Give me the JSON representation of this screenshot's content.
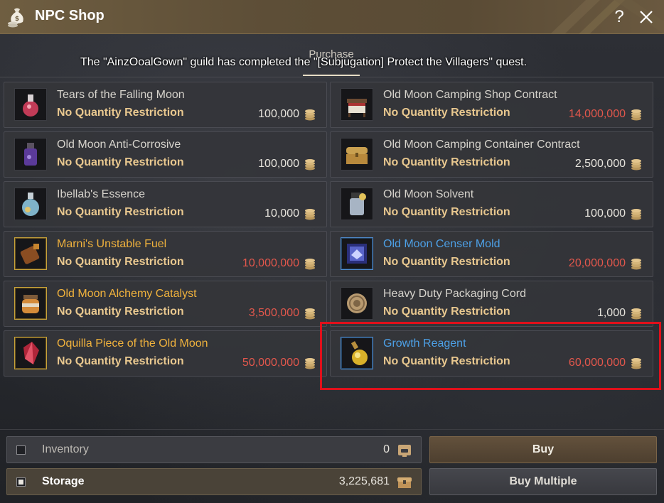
{
  "window": {
    "title": "NPC Shop",
    "title_icon": "money-bag-icon",
    "help_label": "?",
    "close_icon": "close-icon"
  },
  "tabs": {
    "active": "Purchase"
  },
  "notice": "The \"AinzOoalGown\" guild has completed the \"[Subjugation] Protect the Villagers\" quest.",
  "items": [
    {
      "name": "Tears of the Falling Moon",
      "restriction": "No Quantity Restriction",
      "price": "100,000",
      "grade": "white",
      "price_color": "normal",
      "icon": "potion-flask-icon"
    },
    {
      "name": "Old Moon Camping Shop Contract",
      "restriction": "No Quantity Restriction",
      "price": "14,000,000",
      "grade": "white",
      "price_color": "red",
      "icon": "shop-stall-icon"
    },
    {
      "name": "Old Moon Anti-Corrosive",
      "restriction": "No Quantity Restriction",
      "price": "100,000",
      "grade": "white",
      "price_color": "normal",
      "icon": "purple-bottle-icon"
    },
    {
      "name": "Old Moon Camping Container Contract",
      "restriction": "No Quantity Restriction",
      "price": "2,500,000",
      "grade": "white",
      "price_color": "normal",
      "icon": "treasure-chest-icon"
    },
    {
      "name": "Ibellab's Essence",
      "restriction": "No Quantity Restriction",
      "price": "10,000",
      "grade": "white",
      "price_color": "normal",
      "icon": "essence-flask-icon"
    },
    {
      "name": "Old Moon Solvent",
      "restriction": "No Quantity Restriction",
      "price": "100,000",
      "grade": "white",
      "price_color": "normal",
      "icon": "solvent-jar-icon"
    },
    {
      "name": "Marni's Unstable Fuel",
      "restriction": "No Quantity Restriction",
      "price": "10,000,000",
      "grade": "gold",
      "price_color": "red",
      "icon": "fuel-canister-icon"
    },
    {
      "name": "Old Moon Censer Mold",
      "restriction": "No Quantity Restriction",
      "price": "20,000,000",
      "grade": "blue",
      "price_color": "red",
      "icon": "censer-mold-icon"
    },
    {
      "name": "Old Moon Alchemy Catalyst",
      "restriction": "No Quantity Restriction",
      "price": "3,500,000",
      "grade": "gold",
      "price_color": "red",
      "icon": "catalyst-jar-icon"
    },
    {
      "name": "Heavy Duty Packaging Cord",
      "restriction": "No Quantity Restriction",
      "price": "1,000",
      "grade": "white",
      "price_color": "normal",
      "icon": "rope-coil-icon"
    },
    {
      "name": "Oquilla Piece of the Old Moon",
      "restriction": "No Quantity Restriction",
      "price": "50,000,000",
      "grade": "gold",
      "price_color": "red",
      "icon": "red-crystal-icon"
    },
    {
      "name": "Growth Reagent",
      "restriction": "No Quantity Restriction",
      "price": "60,000,000",
      "grade": "blue",
      "price_color": "red",
      "icon": "reagent-flask-icon"
    }
  ],
  "funds": {
    "inventory": {
      "label": "Inventory",
      "amount": "0",
      "checked": false,
      "icon": "inventory-icon"
    },
    "storage": {
      "label": "Storage",
      "amount": "3,225,681",
      "checked": true,
      "icon": "storage-chest-icon"
    }
  },
  "buttons": {
    "buy": "Buy",
    "buy_multiple": "Buy Multiple"
  },
  "colors": {
    "gold_grade": "#f0b23d",
    "blue_grade": "#4da0e6",
    "red_price": "#e2574c",
    "restriction": "#e9c88f",
    "highlight": "#e0101b"
  }
}
